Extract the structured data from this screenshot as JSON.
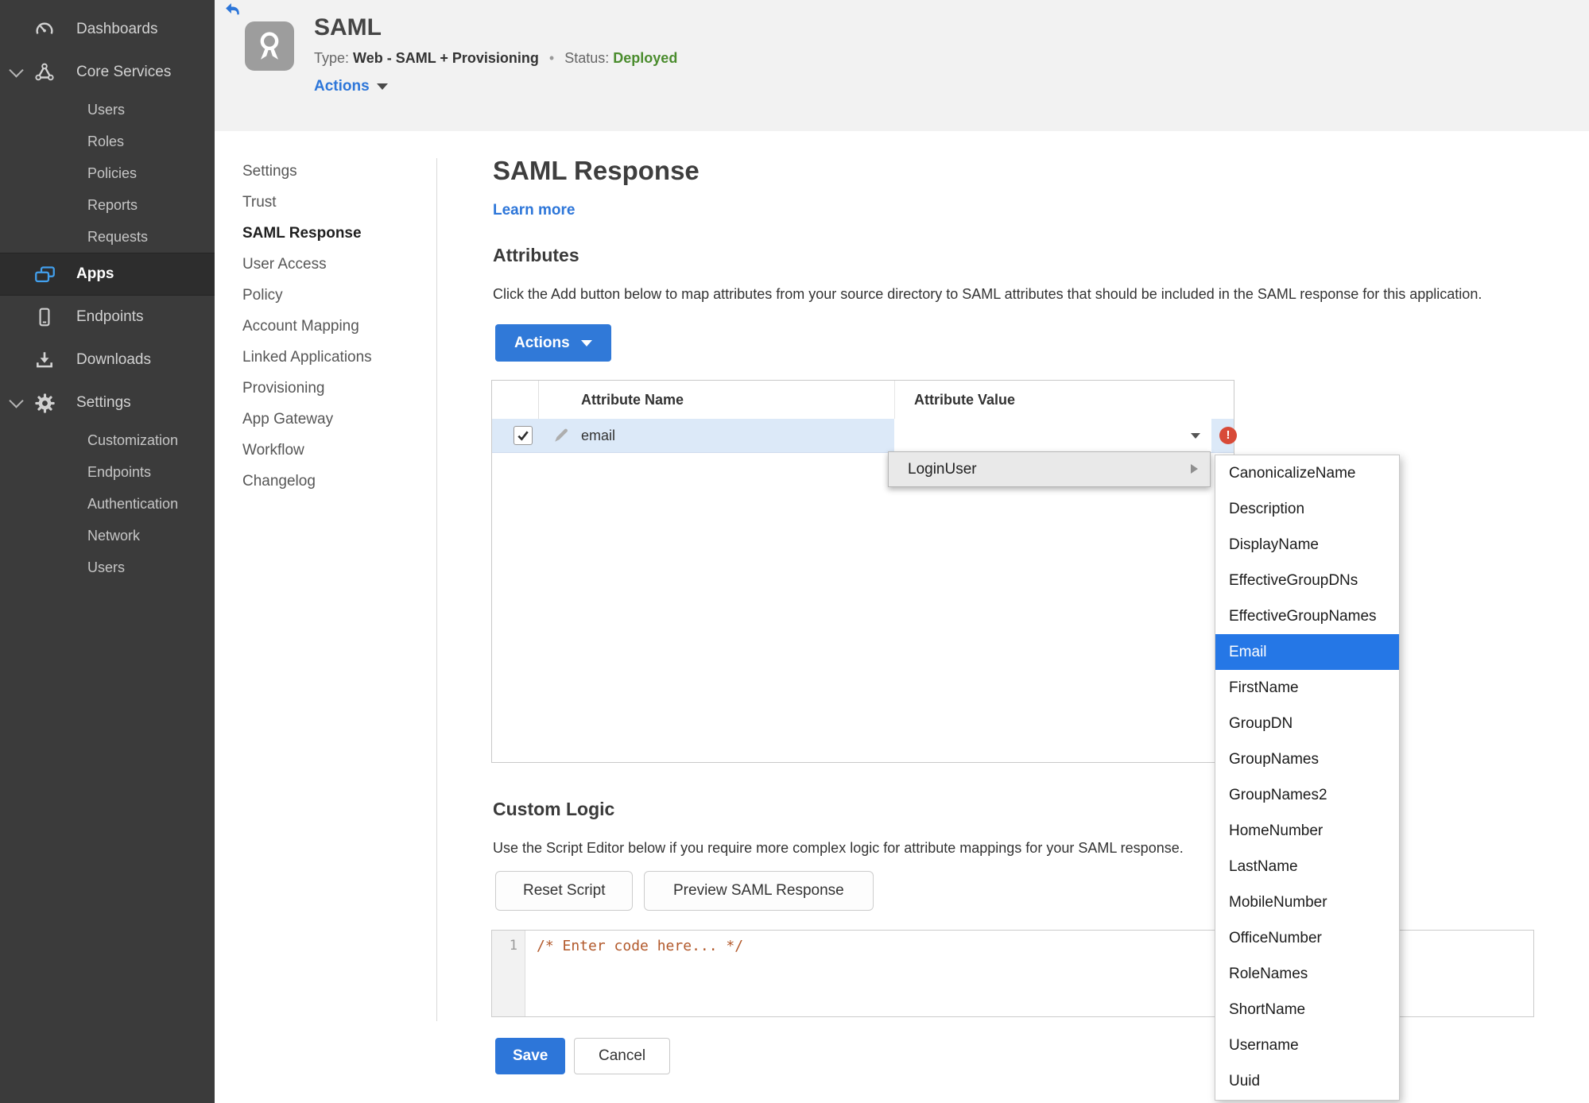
{
  "sidebar": {
    "items": [
      {
        "label": "Dashboards",
        "icon": "gauge-icon",
        "level": 0
      },
      {
        "label": "Core Services",
        "icon": "core-services-icon",
        "level": 0,
        "expanded": true
      },
      {
        "label": "Users",
        "level": 1
      },
      {
        "label": "Roles",
        "level": 1
      },
      {
        "label": "Policies",
        "level": 1
      },
      {
        "label": "Reports",
        "level": 1
      },
      {
        "label": "Requests",
        "level": 1
      },
      {
        "label": "Apps",
        "icon": "apps-icon",
        "level": 0,
        "active": true
      },
      {
        "label": "Endpoints",
        "icon": "endpoint-icon",
        "level": 0
      },
      {
        "label": "Downloads",
        "icon": "download-icon",
        "level": 0
      },
      {
        "label": "Settings",
        "icon": "gear-icon",
        "level": 0,
        "expanded": true
      },
      {
        "label": "Customization",
        "level": 1
      },
      {
        "label": "Endpoints",
        "level": 1
      },
      {
        "label": "Authentication",
        "level": 1
      },
      {
        "label": "Network",
        "level": 1
      },
      {
        "label": "Users",
        "level": 1
      }
    ]
  },
  "header": {
    "app_name": "SAML",
    "type_label": "Type:",
    "type_value": "Web - SAML + Provisioning",
    "separator": "•",
    "status_label": "Status:",
    "status_value": "Deployed",
    "actions_label": "Actions"
  },
  "subnav": {
    "items": [
      "Settings",
      "Trust",
      "SAML Response",
      "User Access",
      "Policy",
      "Account Mapping",
      "Linked Applications",
      "Provisioning",
      "App Gateway",
      "Workflow",
      "Changelog"
    ],
    "active": "SAML Response"
  },
  "main": {
    "title": "SAML Response",
    "learn_more": "Learn more",
    "attributes": {
      "heading": "Attributes",
      "description": "Click the Add button below to map attributes from your source directory to SAML attributes that should be included in the SAML response for this application.",
      "actions_button": "Actions",
      "table": {
        "columns": [
          "Attribute Name",
          "Attribute Value"
        ],
        "rows": [
          {
            "name": "email",
            "value": "",
            "checked": true,
            "error": true
          }
        ]
      }
    },
    "custom_logic": {
      "heading": "Custom Logic",
      "description": "Use the Script Editor below if you require more complex logic for attribute mappings for your SAML response.",
      "reset_button": "Reset Script",
      "preview_button": "Preview SAML Response",
      "editor": {
        "line_number": "1",
        "code": "/* Enter code here... */"
      }
    },
    "save_button": "Save",
    "cancel_button": "Cancel"
  },
  "dropdown": {
    "parent_item": "LoginUser",
    "selected": "Email",
    "options": [
      "CanonicalizeName",
      "Description",
      "DisplayName",
      "EffectiveGroupDNs",
      "EffectiveGroupNames",
      "Email",
      "FirstName",
      "GroupDN",
      "GroupNames",
      "GroupNames2",
      "HomeNumber",
      "LastName",
      "MobileNumber",
      "OfficeNumber",
      "RoleNames",
      "ShortName",
      "Username",
      "Uuid"
    ]
  },
  "colors": {
    "accent_blue": "#2d76d9",
    "status_green": "#4a8c2d",
    "error_red": "#d84a38",
    "selection_blue": "#2577e6",
    "row_highlight": "#dce9f8",
    "sidebar_bg": "#3b3b3b"
  }
}
